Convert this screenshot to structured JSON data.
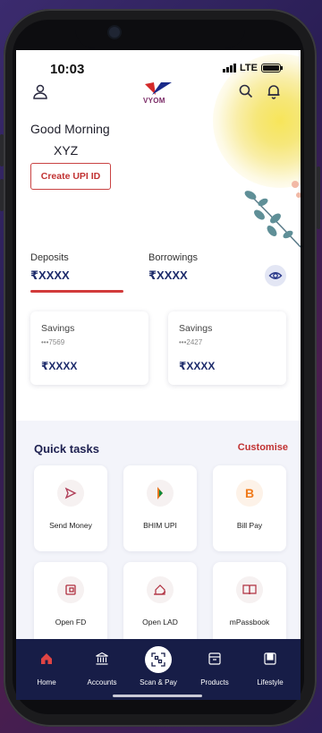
{
  "status_bar": {
    "time": "10:03",
    "network": "LTE"
  },
  "header": {
    "logo_text": "VYOM"
  },
  "greeting": {
    "text": "Good Morning",
    "name": "XYZ"
  },
  "upi": {
    "label": "Create UPI ID"
  },
  "summary": {
    "deposits_label": "Deposits",
    "deposits_value": "₹XXXX",
    "borrowings_label": "Borrowings",
    "borrowings_value": "₹XXXX"
  },
  "accounts": [
    {
      "type": "Savings",
      "number": "•••7569",
      "amount": "₹XXXX"
    },
    {
      "type": "Savings",
      "number": "•••2427",
      "amount": "₹XXXX"
    }
  ],
  "quick_tasks": {
    "title": "Quick tasks",
    "customise": "Customise",
    "items": [
      {
        "label": "Send Money",
        "icon": "send-icon"
      },
      {
        "label": "BHIM UPI",
        "icon": "bhim-upi-icon"
      },
      {
        "label": "Bill Pay",
        "icon": "bill-pay-icon"
      },
      {
        "label": "Open FD",
        "icon": "fd-icon"
      },
      {
        "label": "Open LAD",
        "icon": "lad-icon"
      },
      {
        "label": "mPassbook",
        "icon": "passbook-icon"
      }
    ]
  },
  "nav": [
    {
      "label": "Home",
      "icon": "home-icon",
      "active": true
    },
    {
      "label": "Accounts",
      "icon": "bank-icon"
    },
    {
      "label": "Scan & Pay",
      "icon": "qr-scan-icon"
    },
    {
      "label": "Products",
      "icon": "box-icon"
    },
    {
      "label": "Lifestyle",
      "icon": "lifestyle-icon"
    }
  ],
  "colors": {
    "accent_red": "#c13232",
    "navy": "#1d2b6b",
    "nav_bg": "#171d47",
    "glow": "#f7e55a"
  }
}
